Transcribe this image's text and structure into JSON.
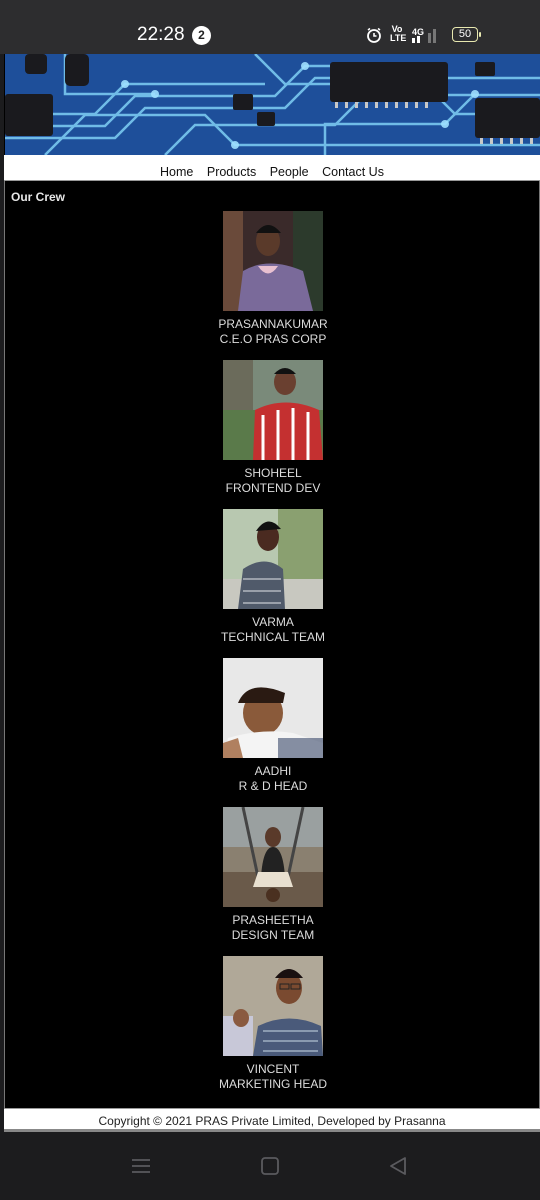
{
  "status": {
    "time": "22:28",
    "notification_count": "2",
    "battery": "50"
  },
  "nav": {
    "items": [
      {
        "label": "Home"
      },
      {
        "label": "Products"
      },
      {
        "label": "People"
      },
      {
        "label": "Contact Us"
      }
    ]
  },
  "crew": {
    "heading": "Our Crew",
    "members": [
      {
        "name": "PRASANNAKUMAR",
        "role": "C.E.O PRAS CORP"
      },
      {
        "name": "SHOHEEL",
        "role": "FRONTEND DEV"
      },
      {
        "name": "VARMA",
        "role": "TECHNICAL TEAM"
      },
      {
        "name": "AADHI",
        "role": "R & D HEAD"
      },
      {
        "name": "PRASHEETHA",
        "role": "DESIGN TEAM"
      },
      {
        "name": "VINCENT",
        "role": "MARKETING HEAD"
      }
    ]
  },
  "footer": {
    "text": "Copyright © 2021 PRAS Private Limited, Developed by Prasanna"
  },
  "icons": {
    "alarm": "alarm-icon",
    "volte": "volte-icon",
    "signal": "signal-4g-icon",
    "battery": "battery-icon",
    "menu": "menu-icon",
    "home": "home-square-icon",
    "back": "back-triangle-icon"
  }
}
